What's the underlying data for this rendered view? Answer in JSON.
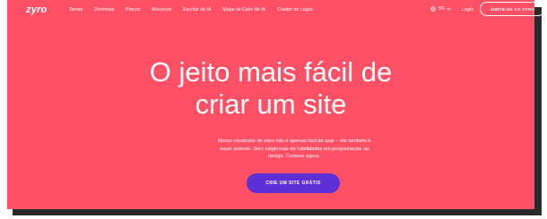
{
  "nav": {
    "logo": "zyro",
    "links": [
      "Temas",
      "Domínios",
      "Preços",
      "Recursos",
      "Escritor de IA",
      "Mapa de Calor de IA",
      "Criador de Logos"
    ],
    "language": "BR",
    "login": "Login",
    "join": "JUNTE-SE AO ZYRO"
  },
  "hero": {
    "title_line1": "O jeito mais fácil de",
    "title_line2": "criar um site",
    "subtitle_line1": "Nosso construtor de sites não é apenas fácil de usar – ele também é",
    "subtitle_line2": "super potente. Sem exigências de habilidades em programação ou",
    "subtitle_line3": "design. Comece agora.",
    "cta": "CRIE UM SITE GRÁTIS"
  },
  "colors": {
    "background": "#ff5066",
    "cta": "#5d2fd6"
  }
}
